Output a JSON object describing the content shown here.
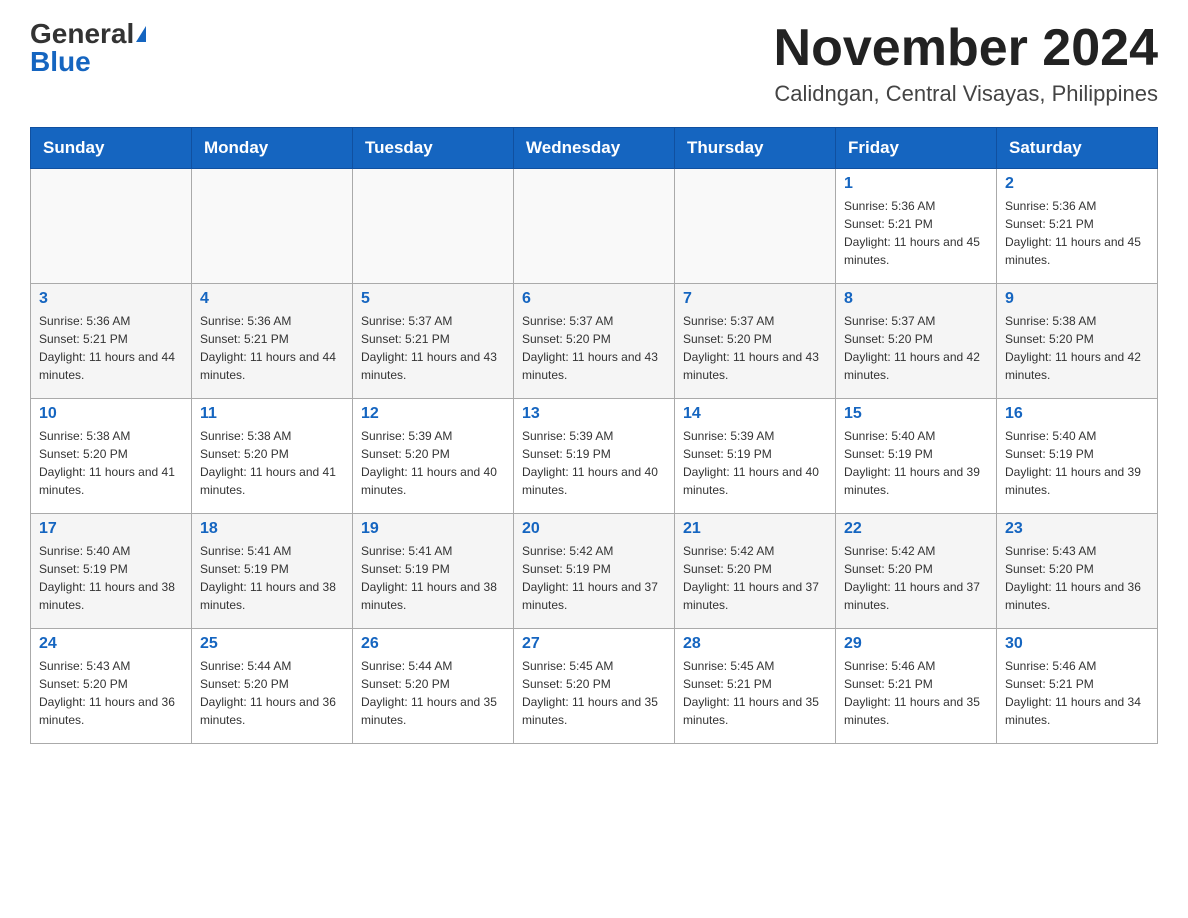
{
  "header": {
    "logo_general": "General",
    "logo_blue": "Blue",
    "month_title": "November 2024",
    "location": "Calidngan, Central Visayas, Philippines"
  },
  "weekdays": [
    "Sunday",
    "Monday",
    "Tuesday",
    "Wednesday",
    "Thursday",
    "Friday",
    "Saturday"
  ],
  "weeks": [
    [
      {
        "day": "",
        "info": ""
      },
      {
        "day": "",
        "info": ""
      },
      {
        "day": "",
        "info": ""
      },
      {
        "day": "",
        "info": ""
      },
      {
        "day": "",
        "info": ""
      },
      {
        "day": "1",
        "info": "Sunrise: 5:36 AM\nSunset: 5:21 PM\nDaylight: 11 hours and 45 minutes."
      },
      {
        "day": "2",
        "info": "Sunrise: 5:36 AM\nSunset: 5:21 PM\nDaylight: 11 hours and 45 minutes."
      }
    ],
    [
      {
        "day": "3",
        "info": "Sunrise: 5:36 AM\nSunset: 5:21 PM\nDaylight: 11 hours and 44 minutes."
      },
      {
        "day": "4",
        "info": "Sunrise: 5:36 AM\nSunset: 5:21 PM\nDaylight: 11 hours and 44 minutes."
      },
      {
        "day": "5",
        "info": "Sunrise: 5:37 AM\nSunset: 5:21 PM\nDaylight: 11 hours and 43 minutes."
      },
      {
        "day": "6",
        "info": "Sunrise: 5:37 AM\nSunset: 5:20 PM\nDaylight: 11 hours and 43 minutes."
      },
      {
        "day": "7",
        "info": "Sunrise: 5:37 AM\nSunset: 5:20 PM\nDaylight: 11 hours and 43 minutes."
      },
      {
        "day": "8",
        "info": "Sunrise: 5:37 AM\nSunset: 5:20 PM\nDaylight: 11 hours and 42 minutes."
      },
      {
        "day": "9",
        "info": "Sunrise: 5:38 AM\nSunset: 5:20 PM\nDaylight: 11 hours and 42 minutes."
      }
    ],
    [
      {
        "day": "10",
        "info": "Sunrise: 5:38 AM\nSunset: 5:20 PM\nDaylight: 11 hours and 41 minutes."
      },
      {
        "day": "11",
        "info": "Sunrise: 5:38 AM\nSunset: 5:20 PM\nDaylight: 11 hours and 41 minutes."
      },
      {
        "day": "12",
        "info": "Sunrise: 5:39 AM\nSunset: 5:20 PM\nDaylight: 11 hours and 40 minutes."
      },
      {
        "day": "13",
        "info": "Sunrise: 5:39 AM\nSunset: 5:19 PM\nDaylight: 11 hours and 40 minutes."
      },
      {
        "day": "14",
        "info": "Sunrise: 5:39 AM\nSunset: 5:19 PM\nDaylight: 11 hours and 40 minutes."
      },
      {
        "day": "15",
        "info": "Sunrise: 5:40 AM\nSunset: 5:19 PM\nDaylight: 11 hours and 39 minutes."
      },
      {
        "day": "16",
        "info": "Sunrise: 5:40 AM\nSunset: 5:19 PM\nDaylight: 11 hours and 39 minutes."
      }
    ],
    [
      {
        "day": "17",
        "info": "Sunrise: 5:40 AM\nSunset: 5:19 PM\nDaylight: 11 hours and 38 minutes."
      },
      {
        "day": "18",
        "info": "Sunrise: 5:41 AM\nSunset: 5:19 PM\nDaylight: 11 hours and 38 minutes."
      },
      {
        "day": "19",
        "info": "Sunrise: 5:41 AM\nSunset: 5:19 PM\nDaylight: 11 hours and 38 minutes."
      },
      {
        "day": "20",
        "info": "Sunrise: 5:42 AM\nSunset: 5:19 PM\nDaylight: 11 hours and 37 minutes."
      },
      {
        "day": "21",
        "info": "Sunrise: 5:42 AM\nSunset: 5:20 PM\nDaylight: 11 hours and 37 minutes."
      },
      {
        "day": "22",
        "info": "Sunrise: 5:42 AM\nSunset: 5:20 PM\nDaylight: 11 hours and 37 minutes."
      },
      {
        "day": "23",
        "info": "Sunrise: 5:43 AM\nSunset: 5:20 PM\nDaylight: 11 hours and 36 minutes."
      }
    ],
    [
      {
        "day": "24",
        "info": "Sunrise: 5:43 AM\nSunset: 5:20 PM\nDaylight: 11 hours and 36 minutes."
      },
      {
        "day": "25",
        "info": "Sunrise: 5:44 AM\nSunset: 5:20 PM\nDaylight: 11 hours and 36 minutes."
      },
      {
        "day": "26",
        "info": "Sunrise: 5:44 AM\nSunset: 5:20 PM\nDaylight: 11 hours and 35 minutes."
      },
      {
        "day": "27",
        "info": "Sunrise: 5:45 AM\nSunset: 5:20 PM\nDaylight: 11 hours and 35 minutes."
      },
      {
        "day": "28",
        "info": "Sunrise: 5:45 AM\nSunset: 5:21 PM\nDaylight: 11 hours and 35 minutes."
      },
      {
        "day": "29",
        "info": "Sunrise: 5:46 AM\nSunset: 5:21 PM\nDaylight: 11 hours and 35 minutes."
      },
      {
        "day": "30",
        "info": "Sunrise: 5:46 AM\nSunset: 5:21 PM\nDaylight: 11 hours and 34 minutes."
      }
    ]
  ]
}
